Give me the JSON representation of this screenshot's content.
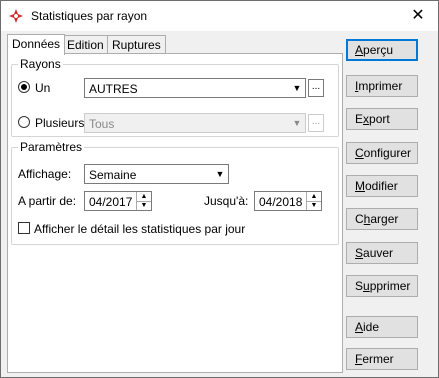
{
  "window": {
    "title": "Statistiques par rayon",
    "close_glyph": "✕"
  },
  "tabs": [
    {
      "label": "Données"
    },
    {
      "label": "Edition"
    },
    {
      "label": "Ruptures"
    }
  ],
  "rayons": {
    "label": "Rayons",
    "un_label": "Un",
    "un_value": "AUTRES",
    "plusieurs_label": "Plusieurs",
    "plusieurs_value": "Tous",
    "ellipsis": "..."
  },
  "parametres": {
    "label": "Paramètres",
    "affichage_label": "Affichage:",
    "affichage_value": "Semaine",
    "apartir_label": "A partir de:",
    "apartir_value": "04/2017",
    "jusqua_label": "Jusqu'à:",
    "jusqua_value": "04/2018",
    "detail_label": "Afficher le détail les statistiques par jour"
  },
  "buttons": [
    {
      "pre": "",
      "acc": "A",
      "post": "perçu"
    },
    {
      "pre": "",
      "acc": "I",
      "post": "mprimer"
    },
    {
      "pre": "E",
      "acc": "x",
      "post": "port"
    },
    {
      "pre": "",
      "acc": "C",
      "post": "onfigurer"
    },
    {
      "pre": "",
      "acc": "M",
      "post": "odifier"
    },
    {
      "pre": "C",
      "acc": "h",
      "post": "arger"
    },
    {
      "pre": "",
      "acc": "S",
      "post": "auver"
    },
    {
      "pre": "S",
      "acc": "u",
      "post": "pprimer"
    },
    {
      "pre": "",
      "acc": "A",
      "post": "ide"
    },
    {
      "pre": "",
      "acc": "F",
      "post": "ermer"
    }
  ]
}
